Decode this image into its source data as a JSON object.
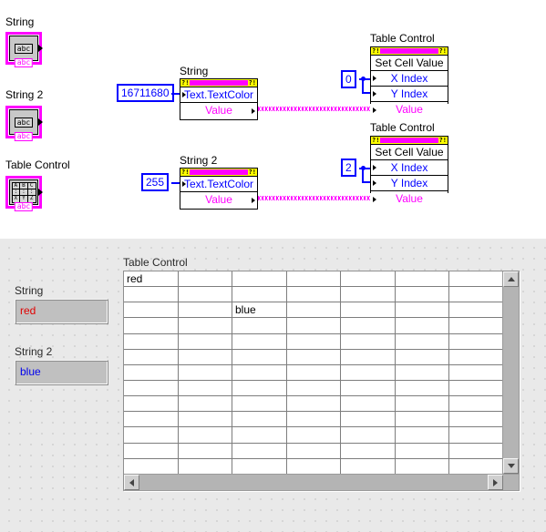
{
  "block_diagram": {
    "terminals": [
      {
        "label": "String",
        "icon": "string-terminal-icon",
        "tag": "abc"
      },
      {
        "label": "String 2",
        "icon": "string-terminal-icon",
        "tag": "abc"
      },
      {
        "label": "Table Control",
        "icon": "table-terminal-icon",
        "tag": "abc",
        "grid": [
          "A",
          "B",
          "C",
          ":",
          ":",
          ":",
          "X",
          "Y",
          "Z"
        ]
      }
    ],
    "constants": [
      {
        "value": "16711680",
        "name": "color-constant-red"
      },
      {
        "value": "255",
        "name": "color-constant-blue"
      },
      {
        "value": "0",
        "name": "index-constant-zero"
      },
      {
        "value": "2",
        "name": "index-constant-two"
      }
    ],
    "property_nodes": [
      {
        "title": "String",
        "header_glyph": "?!",
        "rows": [
          {
            "label": "Text.TextColor",
            "color": "blue",
            "in": true,
            "out": false
          },
          {
            "label": "Value",
            "color": "magenta",
            "in": false,
            "out": true
          }
        ]
      },
      {
        "title": "String 2",
        "header_glyph": "?!",
        "rows": [
          {
            "label": "Text.TextColor",
            "color": "blue",
            "in": true,
            "out": false
          },
          {
            "label": "Value",
            "color": "magenta",
            "in": false,
            "out": true
          }
        ]
      }
    ],
    "invoke_nodes": [
      {
        "title": "Table Control",
        "header_glyph": "?!",
        "method": "Set Cell Value",
        "rows": [
          {
            "label": "X Index",
            "color": "blue"
          },
          {
            "label": "Y Index",
            "color": "blue"
          },
          {
            "label": "Value",
            "color": "magenta"
          }
        ]
      },
      {
        "title": "Table Control",
        "header_glyph": "?!",
        "method": "Set Cell Value",
        "rows": [
          {
            "label": "X Index",
            "color": "blue"
          },
          {
            "label": "Y Index",
            "color": "blue"
          },
          {
            "label": "Value",
            "color": "magenta"
          }
        ]
      }
    ]
  },
  "front_panel": {
    "controls": [
      {
        "label": "String",
        "value": "red",
        "text_color": "#e00000"
      },
      {
        "label": "String 2",
        "value": "blue",
        "text_color": "#0000ee"
      }
    ],
    "table": {
      "label": "Table Control",
      "rows": 13,
      "cols": 8,
      "cells": [
        {
          "row": 0,
          "col": 0,
          "text": "red"
        },
        {
          "row": 2,
          "col": 2,
          "text": "blue"
        }
      ],
      "scroll_up": "▲",
      "scroll_down": "▼",
      "scroll_left": "◀",
      "scroll_right": "▶"
    }
  },
  "colors": {
    "wire_string": "#ff00ff",
    "wire_numeric": "#0000ff",
    "terminal_border": "#ff00ff",
    "node_header": "#ffff00",
    "accent_magenta": "#ff00ff"
  }
}
